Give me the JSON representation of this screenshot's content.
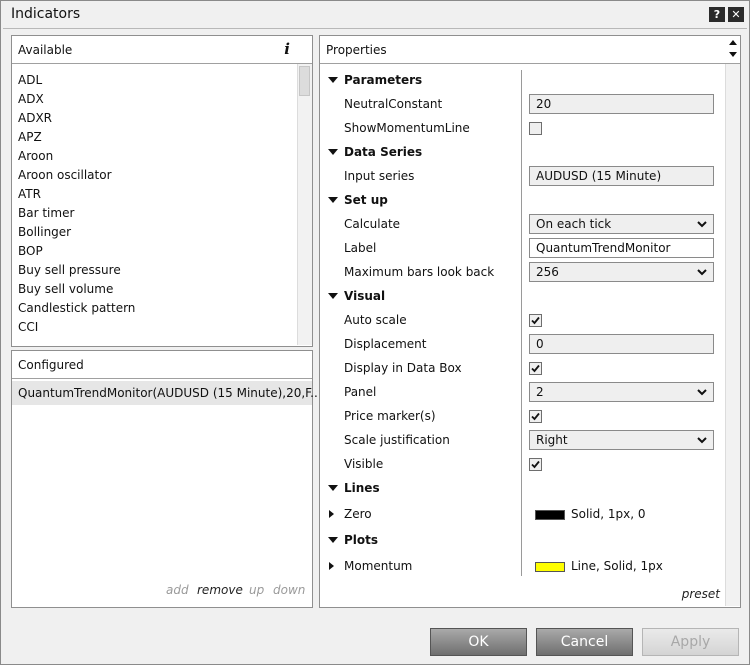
{
  "window": {
    "title": "Indicators",
    "help_icon": "?",
    "close_icon": "✕"
  },
  "available": {
    "header": "Available",
    "info_icon": "i",
    "items": [
      "ADL",
      "ADX",
      "ADXR",
      "APZ",
      "Aroon",
      "Aroon oscillator",
      "ATR",
      "Bar timer",
      "Bollinger",
      "BOP",
      "Buy sell pressure",
      "Buy sell volume",
      "Candlestick pattern",
      "CCI"
    ]
  },
  "configured": {
    "header": "Configured",
    "items": [
      "QuantumTrendMonitor(AUDUSD (15 Minute),20,F..."
    ],
    "actions": {
      "add": "add",
      "remove": "remove",
      "up": "up",
      "down": "down"
    }
  },
  "properties": {
    "header": "Properties",
    "preset": "preset",
    "parameters": {
      "title": "Parameters",
      "neutral_label": "NeutralConstant",
      "neutral_value": "20",
      "show_momentum_label": "ShowMomentumLine",
      "show_momentum_checked": false
    },
    "data_series": {
      "title": "Data Series",
      "input_label": "Input series",
      "input_value": "AUDUSD (15 Minute)"
    },
    "setup": {
      "title": "Set up",
      "calculate_label": "Calculate",
      "calculate_value": "On each tick",
      "label_label": "Label",
      "label_value": "QuantumTrendMonitor",
      "max_bars_label": "Maximum bars look back",
      "max_bars_value": "256"
    },
    "visual": {
      "title": "Visual",
      "auto_scale_label": "Auto scale",
      "auto_scale_checked": true,
      "displacement_label": "Displacement",
      "displacement_value": "0",
      "data_box_label": "Display in Data Box",
      "data_box_checked": true,
      "panel_label": "Panel",
      "panel_value": "2",
      "price_marker_label": "Price marker(s)",
      "price_marker_checked": true,
      "scale_just_label": "Scale justification",
      "scale_just_value": "Right",
      "visible_label": "Visible",
      "visible_checked": true
    },
    "lines": {
      "title": "Lines",
      "zero_label": "Zero",
      "zero_value": "Solid, 1px, 0",
      "zero_color": "#000000"
    },
    "plots": {
      "title": "Plots",
      "momentum_label": "Momentum",
      "momentum_value": "Line, Solid, 1px",
      "momentum_color": "#ffff00"
    }
  },
  "buttons": {
    "ok": "OK",
    "cancel": "Cancel",
    "apply": "Apply"
  }
}
